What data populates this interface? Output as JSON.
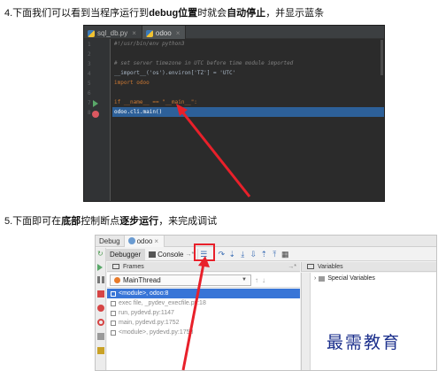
{
  "step4": {
    "prefix": "4.下面我们可以看到当程序运行到",
    "bold1": "debug位置",
    "middle": "时就会",
    "bold2": "自动停止",
    "suffix": "，并显示蓝条"
  },
  "editor": {
    "tabs": [
      {
        "label": "sql_db.py"
      },
      {
        "label": "odoo"
      }
    ],
    "line_numbers": [
      "1",
      "2",
      "3",
      "4",
      "5",
      "6",
      "7",
      "8"
    ],
    "lines": [
      {
        "text": "#!/usr/bin/env python3"
      },
      {
        "text": ""
      },
      {
        "text": "# set server timezone in UTC before time module imported"
      },
      {
        "text": "__import__('os').environ['TZ'] = 'UTC'"
      },
      {
        "text": "import odoo"
      },
      {
        "text": ""
      },
      {
        "text": "if __name__ == \"__main__\":"
      },
      {
        "text": "    odoo.cli.main()"
      }
    ]
  },
  "step5": {
    "prefix": "5.下面即可在",
    "bold1": "底部",
    "middle": "控制断点",
    "bold2": "逐步运行",
    "suffix": "，来完成调试"
  },
  "debug": {
    "title": "Debug",
    "tab": "odoo",
    "debugger_tab": "Debugger",
    "console_tab": "Console",
    "frames_label": "Frames",
    "variables_label": "Variables",
    "thread": "MainThread",
    "frames": [
      {
        "text": "<module>, odoo:8"
      },
      {
        "text": "exec file, _pydev_execfile.py:18"
      },
      {
        "text": "run, pydevd.py:1147"
      },
      {
        "text": "main, pydevd.py:1752"
      },
      {
        "text": "<module>, pydevd.py:1758"
      }
    ],
    "special_variables": "Special Variables"
  },
  "watermark": "最需教育",
  "colors": {
    "arrow": "#e8202a",
    "highlight": "#2d6099",
    "frame_selected": "#3875d7"
  }
}
